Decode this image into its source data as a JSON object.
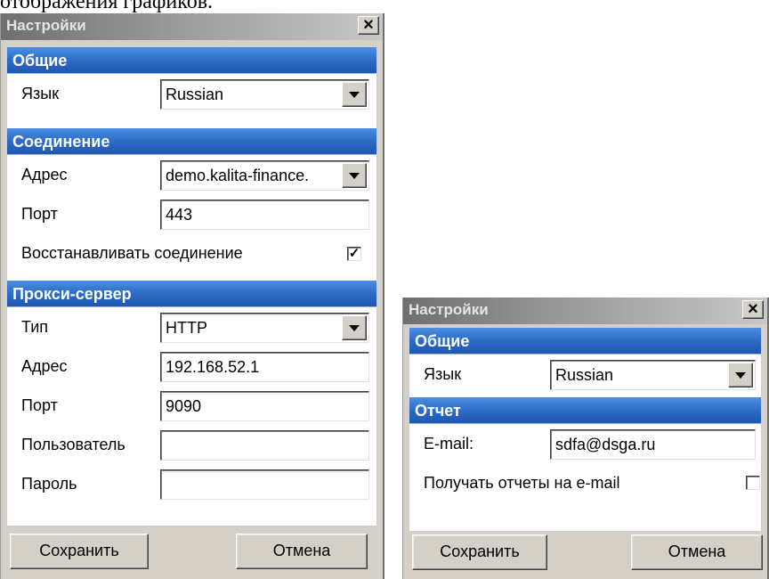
{
  "doc_fragment": "отображения графиков.",
  "dialog1": {
    "title": "Настройки",
    "close_symbol": "×",
    "general": {
      "header": "Общие",
      "language_label": "Язык",
      "language_value": "Russian"
    },
    "connection": {
      "header": "Соединение",
      "address_label": "Адрес",
      "address_value": "demo.kalita-finance.",
      "port_label": "Порт",
      "port_value": "443",
      "restore_label": "Восстанавливать соединение",
      "restore_checked": true,
      "restore_mark": "✓"
    },
    "proxy": {
      "header": "Прокси-сервер",
      "type_label": "Тип",
      "type_value": "HTTP",
      "address_label": "Адрес",
      "address_value": "192.168.52.1",
      "port_label": "Порт",
      "port_value": "9090",
      "user_label": "Пользователь",
      "user_value": "",
      "password_label": "Пароль",
      "password_value": ""
    },
    "save_label": "Сохранить",
    "cancel_label": "Отмена"
  },
  "dialog2": {
    "title": "Настройки",
    "close_symbol": "×",
    "general": {
      "header": "Общие",
      "language_label": "Язык",
      "language_value": "Russian"
    },
    "report": {
      "header": "Отчет",
      "email_label": "E-mail:",
      "email_value": "sdfa@dsga.ru",
      "receive_label": "Получать отчеты на e-mail",
      "receive_checked": false
    },
    "save_label": "Сохранить",
    "cancel_label": "Отмена"
  },
  "colors": {
    "section_header": "#2a69c4",
    "dialog_face": "#d4d0c8",
    "titlebar": "#8c8c8c"
  },
  "icons": [
    "close-icon",
    "dropdown-arrow-icon",
    "checkmark-icon"
  ]
}
